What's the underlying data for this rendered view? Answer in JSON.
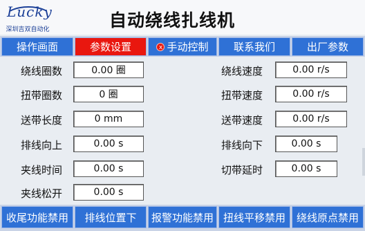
{
  "header": {
    "logo_script": "Lucky",
    "logo_sub": "深圳吉双自动化",
    "title": "自动绕线扎线机"
  },
  "nav": [
    {
      "label": "操作画面"
    },
    {
      "label": "参数设置"
    },
    {
      "label": "手动控制",
      "icon": "x-icon"
    },
    {
      "label": "联系我们"
    },
    {
      "label": "出厂参数"
    }
  ],
  "colors": {
    "nav_blue": "#2f71d6",
    "active_red": "#e9170f",
    "background": "#e9edf2"
  },
  "params": {
    "wind_turns": {
      "label": "绕线圈数",
      "value": "0.00 圈"
    },
    "tie_turns": {
      "label": "扭带圈数",
      "value": "0 圈"
    },
    "feed_length": {
      "label": "送带长度",
      "value": "0 mm"
    },
    "line_up": {
      "label": "排线向上",
      "value": "0.00 s"
    },
    "clamp_time": {
      "label": "夹线时间",
      "value": "0.00 s"
    },
    "clamp_open": {
      "label": "夹线松开",
      "value": "0.00 s"
    },
    "wind_speed": {
      "label": "绕线速度",
      "value": "0.00 r/s"
    },
    "tie_speed": {
      "label": "扭带速度",
      "value": "0.00 r/s"
    },
    "feed_speed": {
      "label": "送带速度",
      "value": "0.00 r/s"
    },
    "line_down": {
      "label": "排线向下",
      "value": "0.00 s"
    },
    "cut_delay": {
      "label": "切带延时",
      "value": "0.00 s"
    }
  },
  "buttons": [
    {
      "label": "收尾功能禁用"
    },
    {
      "label": "排线位置下"
    },
    {
      "label": "报警功能禁用"
    },
    {
      "label": "扭线平移禁用"
    },
    {
      "label": "绕线原点禁用"
    }
  ]
}
